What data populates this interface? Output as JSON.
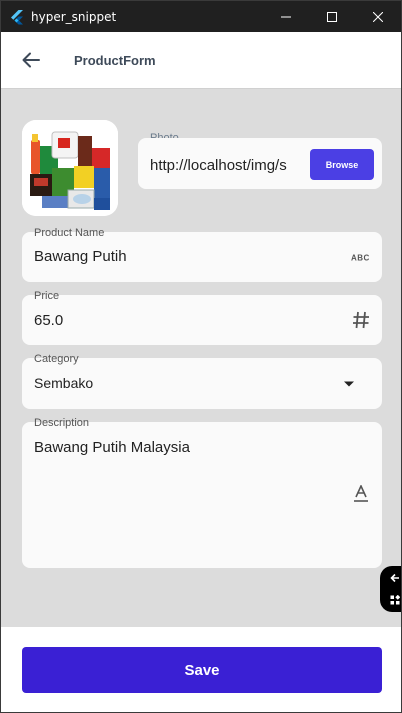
{
  "window": {
    "title": "hyper_snippet"
  },
  "appbar": {
    "title": "ProductForm"
  },
  "photo": {
    "label": "Photo",
    "value": "http://localhost/img/s",
    "browse_label": "Browse"
  },
  "fields": {
    "product_name": {
      "label": "Product Name",
      "value": "Bawang Putih",
      "icon": "abc-icon"
    },
    "price": {
      "label": "Price",
      "value": "65.0",
      "icon": "hash-icon"
    },
    "category": {
      "label": "Category",
      "value": "Sembako",
      "icon": "dropdown-arrow-icon"
    },
    "description": {
      "label": "Description",
      "value": "Bawang Putih Malaysia",
      "icon": "text-format-icon"
    }
  },
  "footer": {
    "save_label": "Save"
  },
  "colors": {
    "primary": "#3a20d4",
    "browse": "#4b3fe4",
    "background": "#dcdcdc",
    "card": "#fafafa"
  }
}
